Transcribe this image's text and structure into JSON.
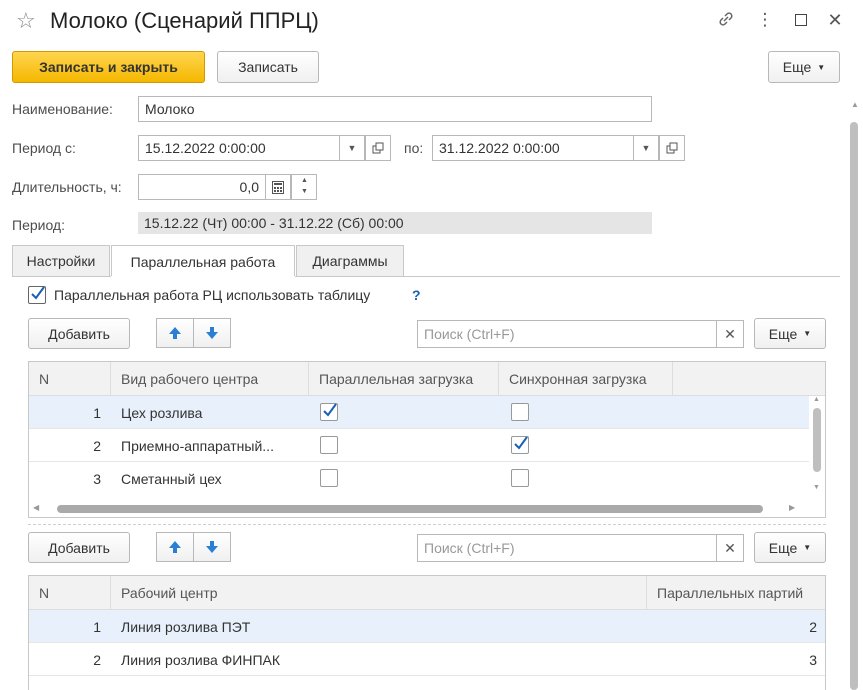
{
  "window": {
    "title": "Молоко (Сценарий ППРЦ)"
  },
  "toolbar": {
    "save_close_label": "Записать и закрыть",
    "save_label": "Записать",
    "more_label": "Еще"
  },
  "form": {
    "name_label": "Наименование:",
    "name_value": "Молоко",
    "period_from_label": "Период с:",
    "period_from_value": "15.12.2022 0:00:00",
    "period_to_label": "по:",
    "period_to_value": "31.12.2022 0:00:00",
    "duration_label": "Длительность, ч:",
    "duration_value": "0,0",
    "period_label": "Период:",
    "period_value": "15.12.22 (Чт) 00:00 - 31.12.22 (Сб) 00:00"
  },
  "tabs": [
    {
      "label": "Настройки"
    },
    {
      "label": "Параллельная работа"
    },
    {
      "label": "Диаграммы"
    }
  ],
  "parallel": {
    "checkbox_label": "Параллельная работа РЦ использовать таблицу",
    "help": "?",
    "add_label": "Добавить",
    "search_placeholder": "Поиск (Ctrl+F)",
    "more_label": "Еще",
    "columns": [
      "N",
      "Вид рабочего центра",
      "Параллельная загрузка",
      "Синхронная загрузка"
    ],
    "rows": [
      {
        "n": "1",
        "name": "Цех розлива",
        "parallel": true,
        "sync": false
      },
      {
        "n": "2",
        "name": "Приемно-аппаратный...",
        "parallel": false,
        "sync": true
      },
      {
        "n": "3",
        "name": "Сметанный цех",
        "parallel": false,
        "sync": false
      }
    ]
  },
  "centers": {
    "add_label": "Добавить",
    "search_placeholder": "Поиск (Ctrl+F)",
    "more_label": "Еще",
    "columns": [
      "N",
      "Рабочий центр",
      "Параллельных партий"
    ],
    "rows": [
      {
        "n": "1",
        "name": "Линия розлива ПЭТ",
        "count": "2"
      },
      {
        "n": "2",
        "name": "Линия розлива ФИНПАК",
        "count": "3"
      }
    ]
  },
  "colors": {
    "accent": "#f5b800",
    "selection": "#e8f1fb",
    "check": "#1a5fb4",
    "arrow": "#2a7fd4"
  }
}
